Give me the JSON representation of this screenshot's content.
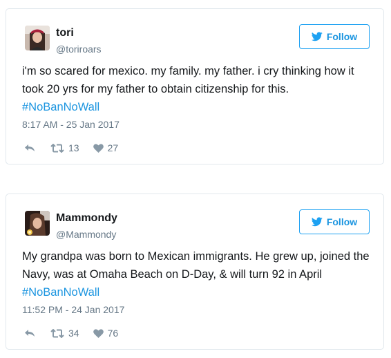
{
  "colors": {
    "link": "#1b95e0",
    "follow_border": "#1da1f2",
    "muted": "#657786",
    "text": "#14171a",
    "card_border": "#e1e8ed"
  },
  "tweets": [
    {
      "name": "tori",
      "handle": "@toriroars",
      "follow_label": "Follow",
      "text": "i'm so scared for mexico. my family. my father. i cry thinking how it took 20 yrs for my father to obtain citizenship for this.",
      "hashtag": "#NoBanNoWall",
      "timestamp": "8:17 AM - 25 Jan 2017",
      "retweets": "13",
      "likes": "27",
      "icons": {
        "reply": "reply-icon",
        "retweet": "retweet-icon",
        "like": "heart-icon",
        "follow": "twitter-bird-icon"
      }
    },
    {
      "name": "Mammondy",
      "handle": "@Mammondy",
      "follow_label": "Follow",
      "text": "My grandpa was born to Mexican immigrants. He grew up, joined the Navy, was at Omaha Beach on D-Day, & will turn 92 in April",
      "hashtag": "#NoBanNoWall",
      "timestamp": "11:52 PM - 24 Jan 2017",
      "retweets": "34",
      "likes": "76",
      "icons": {
        "reply": "reply-icon",
        "retweet": "retweet-icon",
        "like": "heart-icon",
        "follow": "twitter-bird-icon"
      }
    }
  ]
}
